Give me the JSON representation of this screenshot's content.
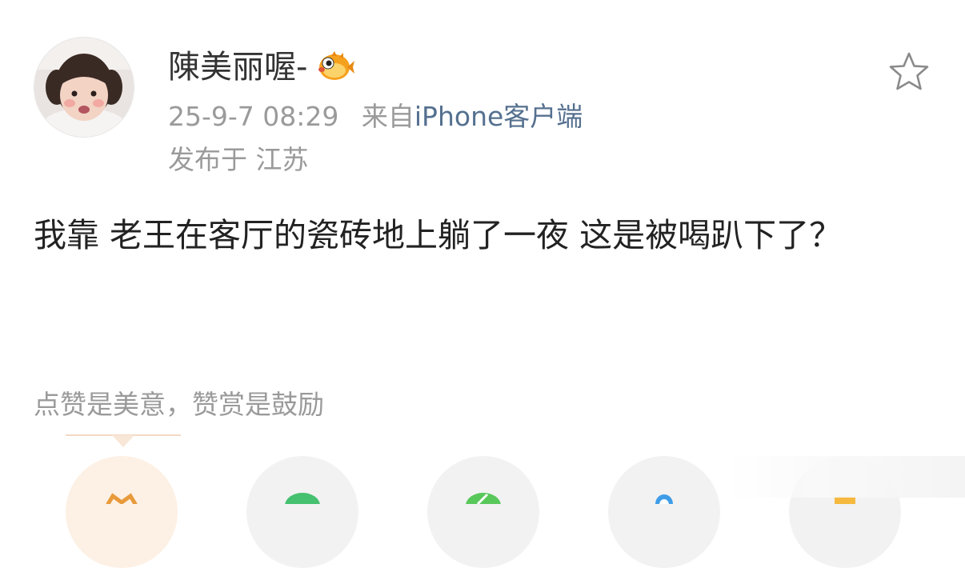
{
  "profile": {
    "username": "陳美丽喔-",
    "avatar_icon": "child-avatar-photo",
    "badge_icon": "pufferfish-badge-icon"
  },
  "post_meta": {
    "time": "25-9-7 08:29",
    "from_label": "来自",
    "client": "iPhone客户端",
    "location": "发布于 江苏"
  },
  "post": {
    "text": "我靠 老王在客厅的瓷砖地上躺了一夜 这是被喝趴下了？"
  },
  "reward": {
    "hint": "点赞是美意，赞赏是鼓励"
  },
  "colors": {
    "link": "#55708f",
    "muted": "#9a9a9a",
    "text": "#222222",
    "reward_bg": "#fdf0e4",
    "wechat": "#45c16f",
    "moments": "#58c85a",
    "qq": "#3f9de8",
    "more": "#f4b93e"
  },
  "actions": [
    {
      "name": "reward-icon"
    },
    {
      "name": "wechat-icon"
    },
    {
      "name": "moments-icon"
    },
    {
      "name": "qq-icon"
    },
    {
      "name": "more-share-icon"
    }
  ]
}
